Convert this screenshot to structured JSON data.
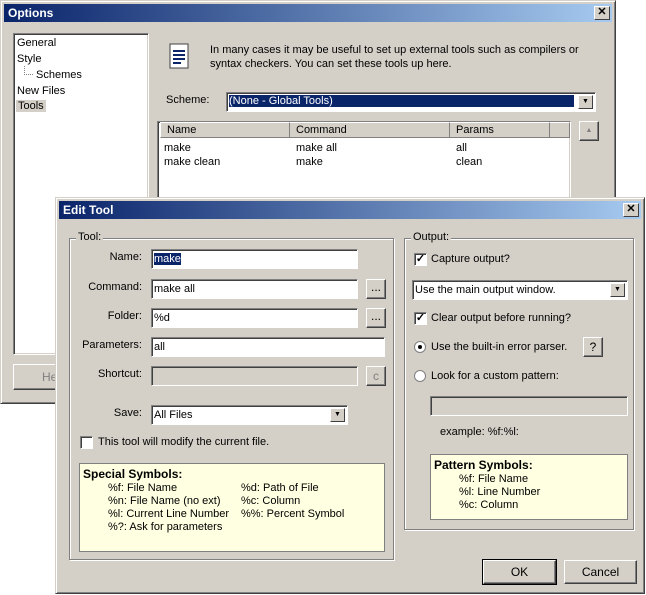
{
  "options": {
    "title": "Options",
    "tree": [
      "General",
      "Style",
      "Schemes",
      "New Files",
      "Tools"
    ],
    "info_text": "In many cases it may be useful to set up external tools such as compilers or syntax checkers. You can set these tools up here.",
    "scheme_label": "Scheme:",
    "scheme_value": "(None - Global Tools)",
    "columns": [
      "Name",
      "Command",
      "Params"
    ],
    "rows": [
      [
        "make",
        "make all",
        "all"
      ],
      [
        "make clean",
        "make",
        "clean"
      ]
    ],
    "help_button_partial": "He"
  },
  "edit": {
    "title": "Edit Tool",
    "tool_group": "Tool:",
    "name_label": "Name:",
    "name_value": "make",
    "command_label": "Command:",
    "command_value": "make all",
    "folder_label": "Folder:",
    "folder_value": "%d",
    "params_label": "Parameters:",
    "params_value": "all",
    "shortcut_label": "Shortcut:",
    "shortcut_value": "",
    "browse_label": "...",
    "clear_label": "c",
    "save_label": "Save:",
    "save_value": "All Files",
    "modify_label": "This tool will modify the current file.",
    "special_title": "Special Symbols:",
    "special_left": [
      "%f: File Name",
      "%n: File Name (no ext)",
      "%l: Current Line Number",
      "%?: Ask for parameters"
    ],
    "special_right": [
      "%d: Path of File",
      "%c: Column",
      "%%: Percent Symbol"
    ],
    "output_group": "Output:",
    "capture_label": "Capture output?",
    "output_select": "Use the main output window.",
    "clear_output_label": "Clear output before running?",
    "builtin_label": "Use the built-in error parser.",
    "help_q": "?",
    "custom_label": "Look for a custom pattern:",
    "pattern_value": "",
    "example_label": "example: %f:%l:",
    "pattern_title": "Pattern Symbols:",
    "pattern_items": [
      "%f: File Name",
      "%l: Line Number",
      "%c: Column"
    ],
    "ok_label": "OK",
    "cancel_label": "Cancel"
  }
}
